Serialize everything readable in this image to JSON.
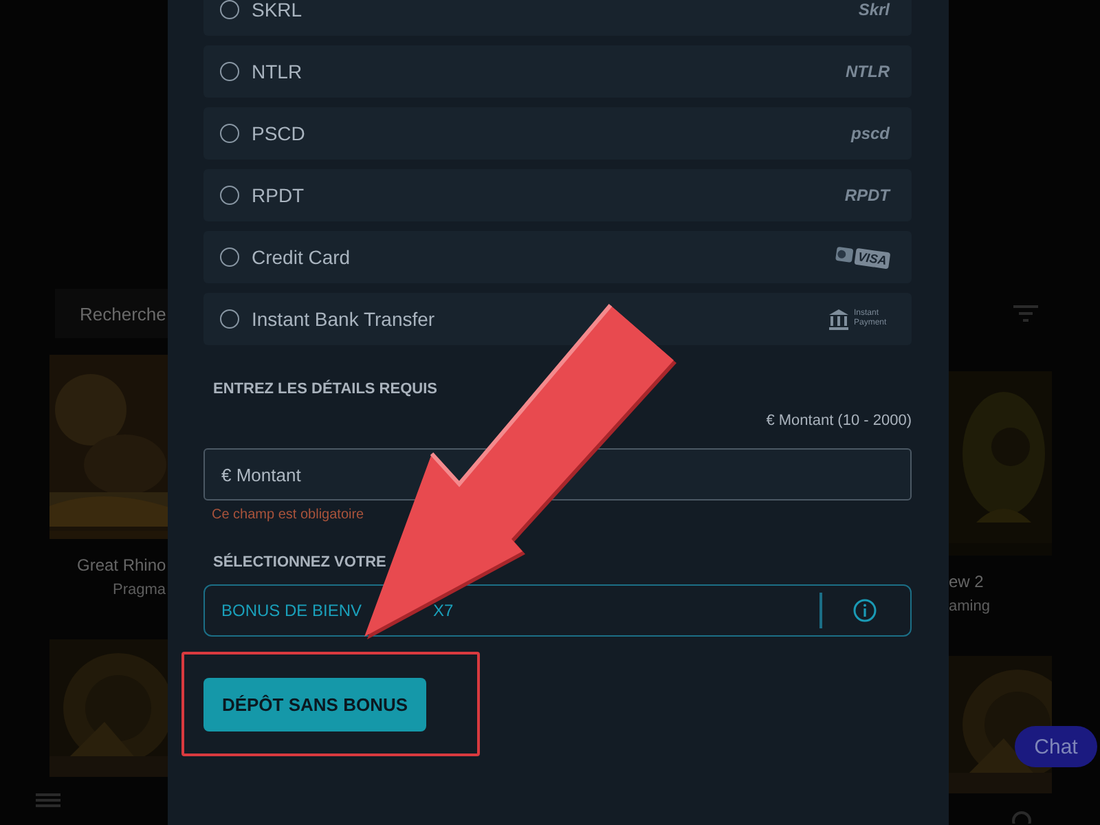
{
  "backdrop": {
    "search_placeholder": "Recherche",
    "games": [
      {
        "title": "Great Rhino",
        "provider": "Pragma"
      },
      {
        "title": "ew 2",
        "provider": "aming"
      }
    ],
    "chat_button": "Chat"
  },
  "payment_methods": [
    {
      "label": "SKRL",
      "kind": "wordmark",
      "logo": "Skrl",
      "selected": false
    },
    {
      "label": "NTLR",
      "kind": "wordmark",
      "logo": "NTLR",
      "selected": false
    },
    {
      "label": "PSCD",
      "kind": "wordmark",
      "logo": "pscd",
      "selected": false
    },
    {
      "label": "RPDT",
      "kind": "wordmark",
      "logo": "RPDT",
      "selected": false
    },
    {
      "label": "Credit Card",
      "kind": "card",
      "logo": "VISA",
      "selected": false
    },
    {
      "label": "Instant Bank Transfer",
      "kind": "bank",
      "logo": "Instant Payment",
      "selected": false
    }
  ],
  "details": {
    "heading": "ENTREZ LES DÉTAILS REQUIS",
    "hint": "€ Montant (10 - 2000)",
    "placeholder": "€ Montant",
    "error": "Ce champ est obligatoire"
  },
  "bonus": {
    "heading": "SÉLECTIONNEZ VOTRE",
    "value_start": "BONUS DE BIENV",
    "value_end": "X7"
  },
  "submit_button": "DÉPÔT SANS BONUS"
}
